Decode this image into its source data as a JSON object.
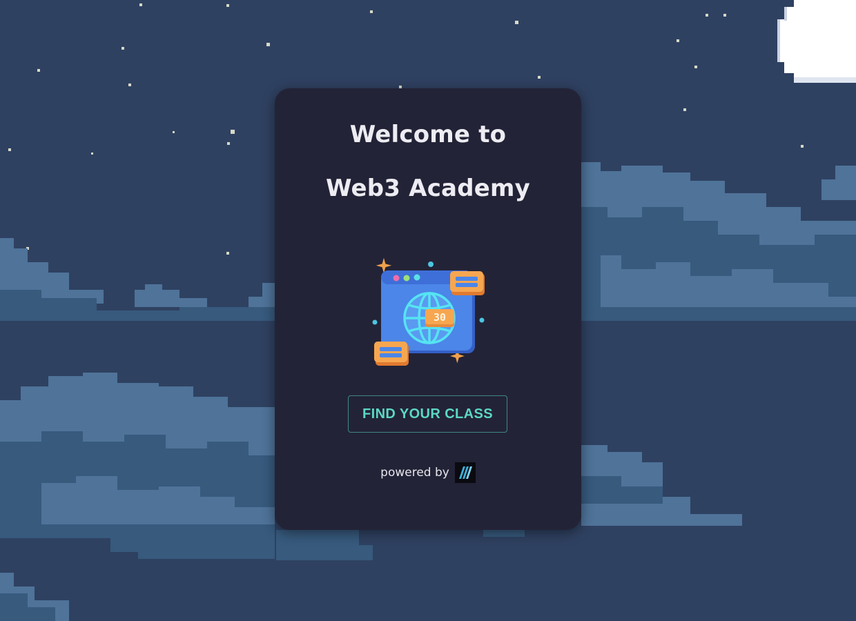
{
  "welcome": {
    "line1": "Welcome to",
    "line2": "Web3 Academy"
  },
  "illustration": {
    "icon": "web3-globe-browser-icon",
    "badge_text": "30"
  },
  "cta": {
    "label": "FIND YOUR CLASS"
  },
  "footer": {
    "powered_by": "powered by",
    "logo_icon": "brand-logo-icon"
  },
  "colors": {
    "sky": "#2f4161",
    "card": "#232337",
    "accent": "#5cd8c4",
    "cloud_light": "#4f7399",
    "cloud_dark": "#375a7d"
  }
}
